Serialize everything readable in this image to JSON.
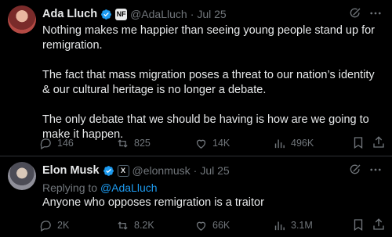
{
  "tweets": [
    {
      "name": "Ada Lluch",
      "affiliate_badge": "NF",
      "handle": "@AdaLluch",
      "separator": "·",
      "date": "Jul 25",
      "paragraphs": [
        "Nothing makes me happier than seeing young people stand up for remigration.",
        "The fact that mass migration poses a threat to our nation’s identity & our cultural heritage is no longer a debate.",
        "The only debate that we should be having is how are we going to make it happen."
      ],
      "stats": {
        "replies": "146",
        "reposts": "825",
        "likes": "14K",
        "views": "496K"
      }
    },
    {
      "name": "Elon Musk",
      "affiliate_badge": "X",
      "handle": "@elonmusk",
      "separator": "·",
      "date": "Jul 25",
      "replying_prefix": "Replying to",
      "replying_to": "@AdaLluch",
      "paragraphs": [
        "Anyone who opposes remigration is a traitor"
      ],
      "stats": {
        "replies": "2K",
        "reposts": "8.2K",
        "likes": "66K",
        "views": "3.1M"
      }
    }
  ],
  "icons": {
    "verified": "verified-badge-icon",
    "grok": "grok-icon",
    "more": "more-icon",
    "reply": "reply-icon",
    "repost": "repost-icon",
    "like": "like-icon",
    "views": "views-icon",
    "bookmark": "bookmark-icon",
    "share": "share-icon"
  },
  "colors": {
    "background": "#000000",
    "text": "#e7e9ea",
    "secondary": "#71767b",
    "link": "#1d9bf0",
    "verified": "#1d9bf0",
    "divider": "#2f3336"
  }
}
